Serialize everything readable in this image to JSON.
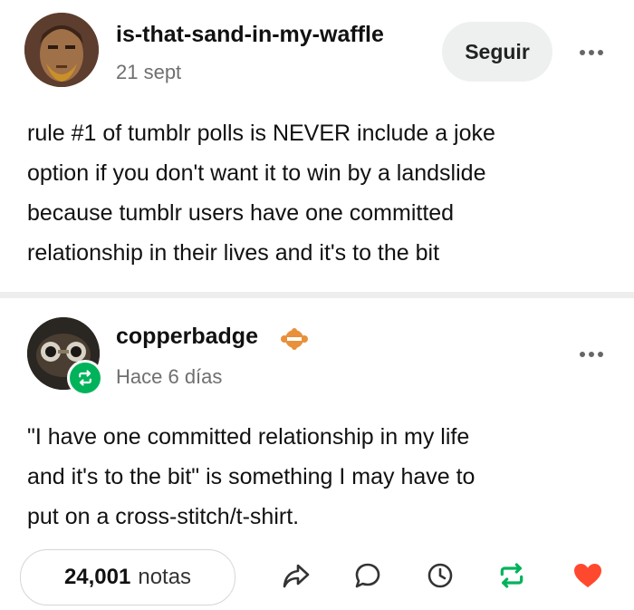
{
  "post1": {
    "username": "is-that-sand-in-my-waffle",
    "timestamp": "21 sept",
    "follow_label": "Seguir",
    "body_lines": [
      "rule #1 of tumblr polls is NEVER include a joke",
      "option if you don't want it to win by a landslide",
      "because tumblr users have one committed",
      "relationship in their lives and it's to the bit"
    ]
  },
  "post2": {
    "username": "copperbadge",
    "timestamp": "Hace 6 días",
    "body_lines": [
      "\"I have one committed relationship in my life",
      "and it's to the bit\" is something I may have to",
      "put on a cross-stitch/t-shirt."
    ]
  },
  "footer": {
    "notes_count": "24,001",
    "notes_label": "notas"
  },
  "icons": [
    "more-icon",
    "reblog-icon",
    "share-icon",
    "reply-icon",
    "history-icon",
    "like-icon"
  ],
  "colors": {
    "reblog_green": "#00b35a",
    "like_red": "#ff492f",
    "follow_bg": "#eef0f0",
    "muted_text": "#6f6f6f"
  }
}
